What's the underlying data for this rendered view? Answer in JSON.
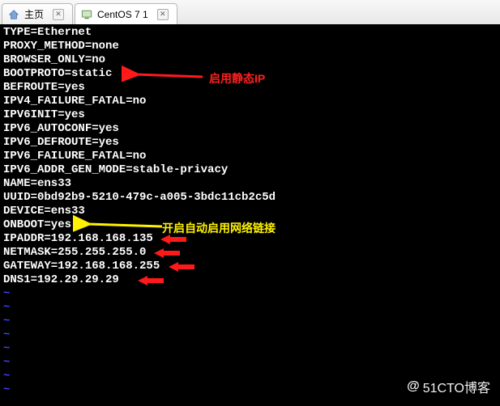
{
  "tabs": {
    "home": {
      "label": "主页"
    },
    "vm": {
      "label": "CentOS 7 1"
    }
  },
  "config_lines": [
    "TYPE=Ethernet",
    "PROXY_METHOD=none",
    "BROWSER_ONLY=no",
    "BOOTPROTO=static",
    "BEFROUTE=yes",
    "IPV4_FAILURE_FATAL=no",
    "IPV6INIT=yes",
    "IPV6_AUTOCONF=yes",
    "IPV6_DEFROUTE=yes",
    "IPV6_FAILURE_FATAL=no",
    "IPV6_ADDR_GEN_MODE=stable-privacy",
    "NAME=ens33",
    "UUID=0bd92b9-5210-479c-a005-3bdc11cb2c5d",
    "DEVICE=ens33",
    "ONBOOT=yes",
    "IPADDR=192.168.168.135",
    "NETMASK=255.255.255.0",
    "GATEWAY=192.168.168.255",
    "DNS1=192.29.29.29"
  ],
  "annotations": {
    "static_ip": "启用静态IP",
    "onboot": "开启自动启用网络链接"
  },
  "watermark": "51CTO博客"
}
